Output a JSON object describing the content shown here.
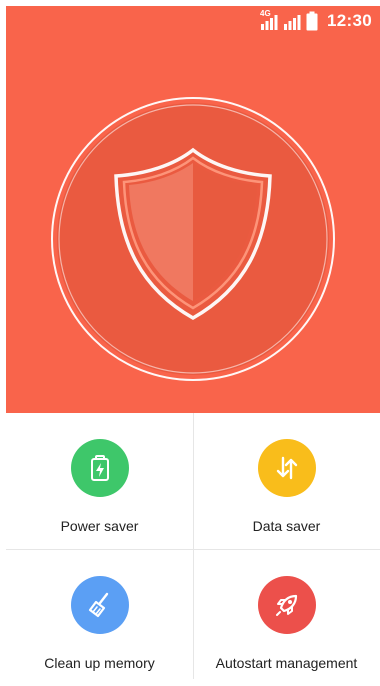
{
  "status_bar": {
    "network_type": "4G",
    "time": "12:30",
    "icons": [
      "signal-icon",
      "signal-icon-2",
      "battery-icon"
    ]
  },
  "hero": {
    "icon": "shield-icon",
    "colors": {
      "background": "#f9644b",
      "ring": "#ffffff",
      "inner_circle": "#ea5a40"
    }
  },
  "tiles": [
    {
      "label": "Power saver",
      "icon": "battery-charging-icon",
      "color": "#3ec76a"
    },
    {
      "label": "Data saver",
      "icon": "data-transfer-icon",
      "color": "#f9bd1b"
    },
    {
      "label": "Clean up memory",
      "icon": "broom-icon",
      "color": "#5b9ff4"
    },
    {
      "label": "Autostart management",
      "icon": "rocket-icon",
      "color": "#ec504b"
    }
  ]
}
